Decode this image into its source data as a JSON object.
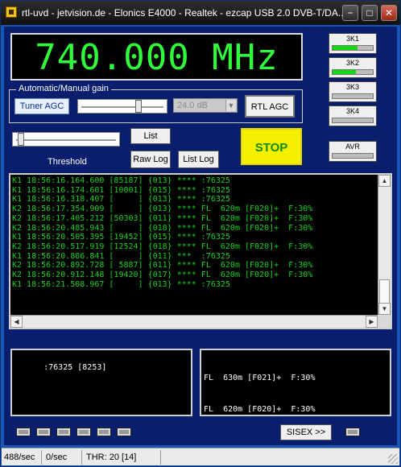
{
  "window": {
    "title": "rtl-uvd - jetvision.de - Elonics E4000 - Realtek - ezcap USB 2.0 DVB-T/DA...",
    "min_glyph": "−",
    "max_glyph": "□",
    "close_glyph": "✕"
  },
  "frequency": {
    "display": "740.000 MHz"
  },
  "gain": {
    "group_label": "Automatic/Manual gain",
    "tuner_agc_label": "Tuner AGC",
    "slider_value_fraction": 0.69,
    "combo_value": "24.0 dB",
    "rtl_agc_label": "RTL AGC"
  },
  "threshold": {
    "label": "Threshold",
    "slider_value_fraction": 0.03
  },
  "buttons": {
    "list": "List",
    "raw_log": "Raw Log",
    "list_log": "List Log",
    "stop": "STOP",
    "sisex": "SISEX >>"
  },
  "indicators": [
    {
      "label": "3K1",
      "level": 0.62
    },
    {
      "label": "3K2",
      "level": 0.58
    },
    {
      "label": "3K3",
      "level": 0.0
    },
    {
      "label": "3K4",
      "level": 0.0
    },
    {
      "label": "AVR",
      "level": 0.0
    }
  ],
  "log_lines": [
    "K1 18:56:16.164.600 [85187] {013} **** :76325",
    "K1 18:56:16.174.601 [10001] {015} **** :76325",
    "K1 18:56:16.318.407 [     ] {013} **** :76325",
    "K2 18:56:17.354.909 [     ] {013} **** FL  620m [F020]+  F:30%",
    "K2 18:56:17.405.212 [50303] {011} **** FL  620m [F020]+  F:30%",
    "K2 18:56:20.485.943 [     ] {018} **** FL  620m [F020]+  F:30%",
    "K1 18:56:20.505.395 [19452] {015} **** :76325",
    "K2 18:56:20.517.919 [12524] {018} **** FL  620m [F020]+  F:30%",
    "K1 18:56:20.886.841 [     ] {011} ***  :76325",
    "K2 18:56:20.892.728 [ 5887] {011} **** FL  620m [F020]+  F:30%",
    "K2 18:56:20.912.148 [19420] {017} **** FL  620m [F020]+  F:30%",
    "K1 18:56:21.508.967 [     ] {013} **** :76325"
  ],
  "pane_left": ":76325 [8253]",
  "pane_right_lines": [
    "FL  630m [F021]+  F:30%",
    "FL  620m [F020]+  F:30%"
  ],
  "scroll": {
    "up": "▲",
    "down": "▼",
    "left": "◀",
    "right": "▶"
  },
  "status": {
    "rate1": "488/sec",
    "rate2": "0/sec",
    "thr": "THR: 20 [14]"
  },
  "colors": {
    "freq_text": "#2fff3a",
    "log_text": "#19d21f",
    "stop_bg": "#f4f000",
    "stop_text": "#128a00",
    "indicator_fill": "#12d812"
  }
}
